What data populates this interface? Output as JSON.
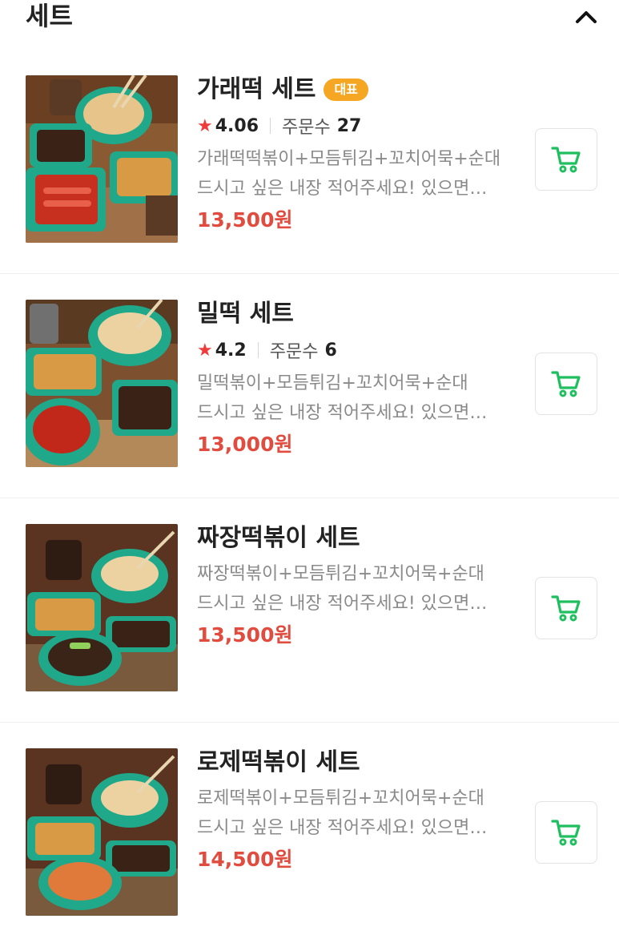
{
  "section": {
    "title": "세트",
    "toggle_icon": "chevron-up-icon"
  },
  "colors": {
    "price": "#e14c3f",
    "star": "#ef3b39",
    "badge": "#f5a623",
    "cart_icon": "#1fbf5f"
  },
  "items": [
    {
      "name": "가래떡 세트",
      "badge": "대표",
      "rating": "4.06",
      "orders_label": "주문수",
      "orders": "27",
      "description": "가래떡떡볶이+모듬튀김+꼬치어묵+순대 드시고 싶은 내장 적어주세요! 있으면 넣어드릴게요",
      "price": "13,500원",
      "image_icon": "food-photo-tteokbokki-set",
      "cart_icon": "shopping-cart-icon"
    },
    {
      "name": "밀떡 세트",
      "badge": "",
      "rating": "4.2",
      "orders_label": "주문수",
      "orders": "6",
      "description": "밀떡볶이+모듬튀김+꼬치어묵+순대 드시고 싶은 내장 적어주세요! 있으면 넣어드릴게요",
      "price": "13,000원",
      "image_icon": "food-photo-tteokbokki-set",
      "cart_icon": "shopping-cart-icon"
    },
    {
      "name": "짜장떡볶이 세트",
      "badge": "",
      "rating": "",
      "orders_label": "",
      "orders": "",
      "description": "짜장떡볶이+모듬튀김+꼬치어묵+순대 드시고 싶은 내장 적어주세요! 있으면 넣어드릴게요",
      "price": "13,500원",
      "image_icon": "food-photo-tteokbokki-set",
      "cart_icon": "shopping-cart-icon"
    },
    {
      "name": "로제떡볶이 세트",
      "badge": "",
      "rating": "",
      "orders_label": "",
      "orders": "",
      "description": "로제떡볶이+모듬튀김+꼬치어묵+순대 드시고 싶은 내장 적어주세요! 있으면 넣어드릴게요",
      "price": "14,500원",
      "image_icon": "food-photo-tteokbokki-set",
      "cart_icon": "shopping-cart-icon"
    }
  ]
}
